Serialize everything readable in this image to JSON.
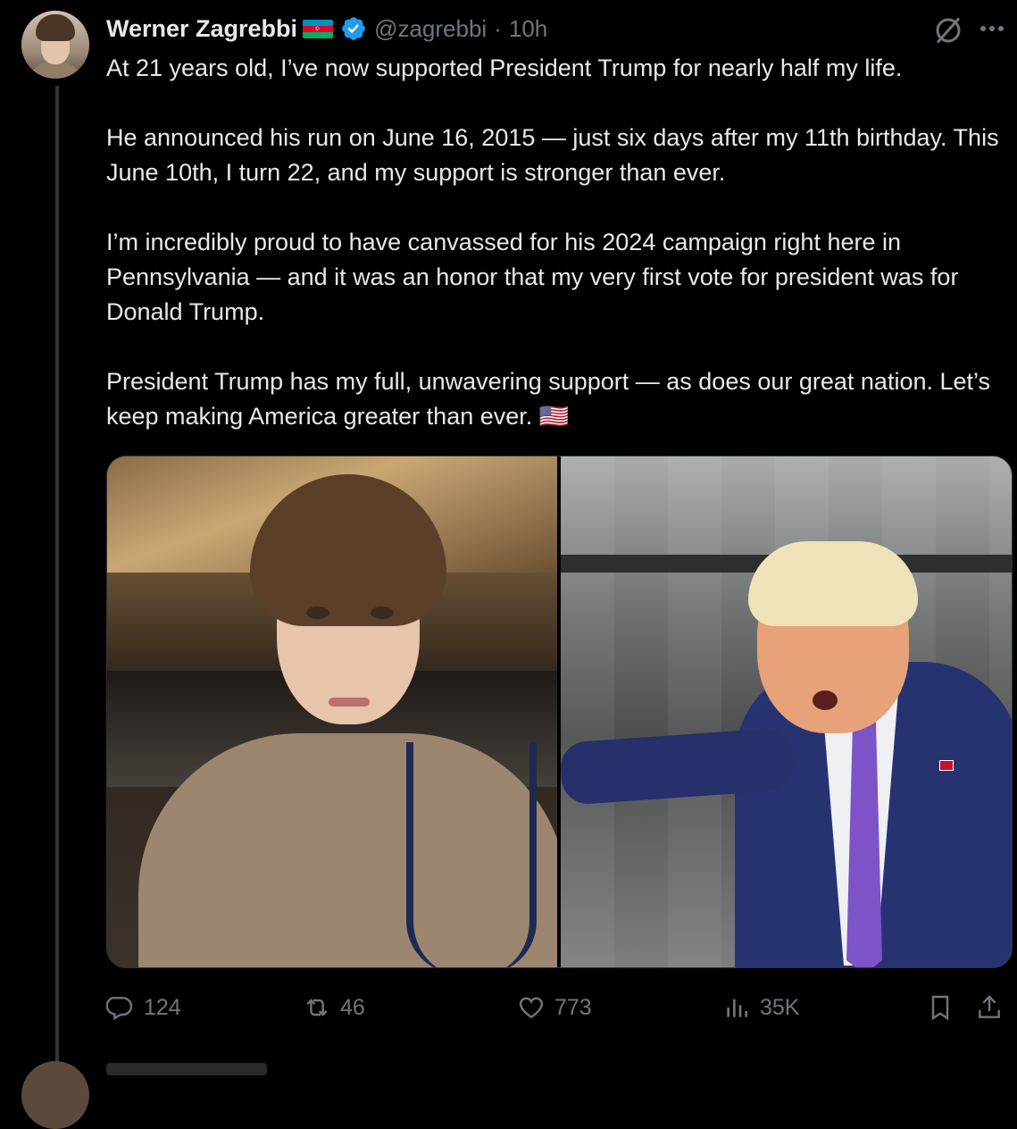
{
  "tweet": {
    "author_name": "Werner Zagrebbi",
    "flag_icon": "azerbaijan-flag-icon",
    "verified": true,
    "handle": "@zagrebbi",
    "separator": "·",
    "time": "10h",
    "text": "At 21 years old, I’ve now supported President Trump for nearly half my life.\n\nHe announced his run on June 16, 2015 — just six days after my 11th birthday. This June 10th, I turn 22, and my support is stronger than ever.\n\nI’m incredibly proud to have canvassed for his 2024 campaign right here in Pennsylvania — and it was an honor that my very first vote for president was for Donald Trump.\n\nPresident Trump has my full, unwavering support — as does our great nation. Let’s keep making America greater than ever. 🇺🇸",
    "media": [
      {
        "type": "photo",
        "subject": "selfie-at-event"
      },
      {
        "type": "photo",
        "subject": "trump-pointing"
      }
    ],
    "stats": {
      "replies": "124",
      "reposts": "46",
      "likes": "773",
      "views": "35K"
    }
  },
  "colors": {
    "background": "#000000",
    "text": "#e7e9ea",
    "muted": "#71767b",
    "verified": "#1d9bf0",
    "border": "#2f3336"
  }
}
